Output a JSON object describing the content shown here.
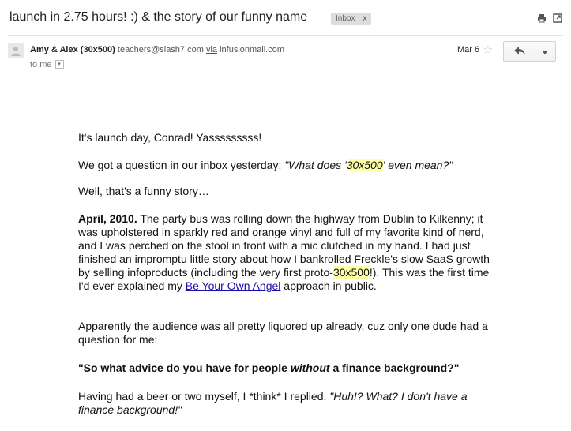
{
  "email": {
    "subject": "launch in 2.75 hours! :) & the story of our funny name",
    "label": {
      "text": "Inbox",
      "close": "x"
    },
    "sender": {
      "name": "Amy & Alex (30x500)",
      "address": "teachers@slash7.com",
      "via_label": "via",
      "via_domain": "infusionmail.com"
    },
    "recipient": "to me",
    "date": "Mar 6"
  },
  "body": {
    "p1": "It's launch day, Conrad! Yasssssssss!",
    "p2_pre": "We got a question in our inbox yesterday: ",
    "p2_q_pre": "\"What does '",
    "p2_q_hl": "30x500",
    "p2_q_post": "' even mean?\"",
    "p3": "Well, that's a funny story…",
    "p4_bold": "April, 2010.",
    "p4_a": " The party bus was rolling down the highway from Dublin to Kilkenny; it was upholstered in sparkly red and orange vinyl and full of my favorite kind of nerd, and I was perched on the stool in front with a mic clutched in my hand. I had just finished an impromptu little story about how I bankrolled Freckle's slow SaaS growth by selling infoproducts (including the very first proto-",
    "p4_hl": "30x500",
    "p4_b": "!). This was the first time I'd ever explained my ",
    "p4_link": "Be Your Own Angel",
    "p4_c": " approach in public.",
    "p5": "Apparently the audience was all pretty liquored up already, cuz only one dude had a question for me:",
    "p6_a": "\"So what advice do you have for people ",
    "p6_em": "without",
    "p6_b": " a finance background?\"",
    "p7_a": "Having had a beer or two myself, I *think* I replied, ",
    "p7_em": "\"Huh!? What? I don't have a finance background!\""
  },
  "icons": {
    "print": "print-icon",
    "popout": "new-window-icon",
    "avatar": "person-icon",
    "star": "star-icon",
    "reply": "reply-icon",
    "more": "chevron-down-icon"
  }
}
